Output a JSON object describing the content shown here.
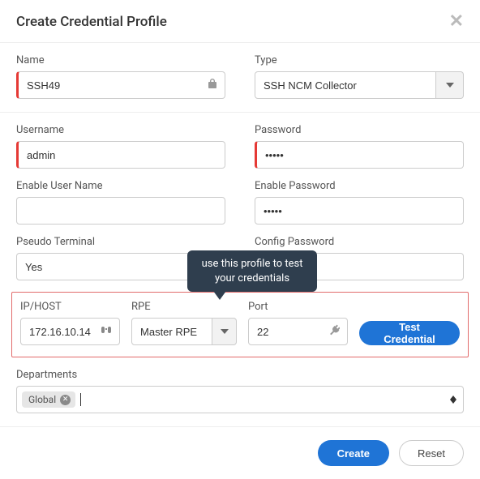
{
  "title": "Create Credential Profile",
  "labels": {
    "name": "Name",
    "type": "Type",
    "username": "Username",
    "password": "Password",
    "enable_user": "Enable User Name",
    "enable_pass": "Enable Password",
    "pseudo_terminal": "Pseudo Terminal",
    "config_pass": "Config Password",
    "ip_host": "IP/HOST",
    "rpe": "RPE",
    "port": "Port",
    "departments": "Departments"
  },
  "values": {
    "name": "SSH49",
    "type": "SSH NCM Collector",
    "username": "admin",
    "password": "•••••",
    "enable_user": "",
    "enable_pass": "•••••",
    "pseudo_terminal": "Yes",
    "config_pass": "",
    "ip_host": "172.16.10.14",
    "rpe": "Master RPE",
    "port": "22",
    "dept_tag": "Global"
  },
  "tooltip": "use this profile to test your credentials",
  "buttons": {
    "test": "Test Credential",
    "create": "Create",
    "reset": "Reset"
  }
}
